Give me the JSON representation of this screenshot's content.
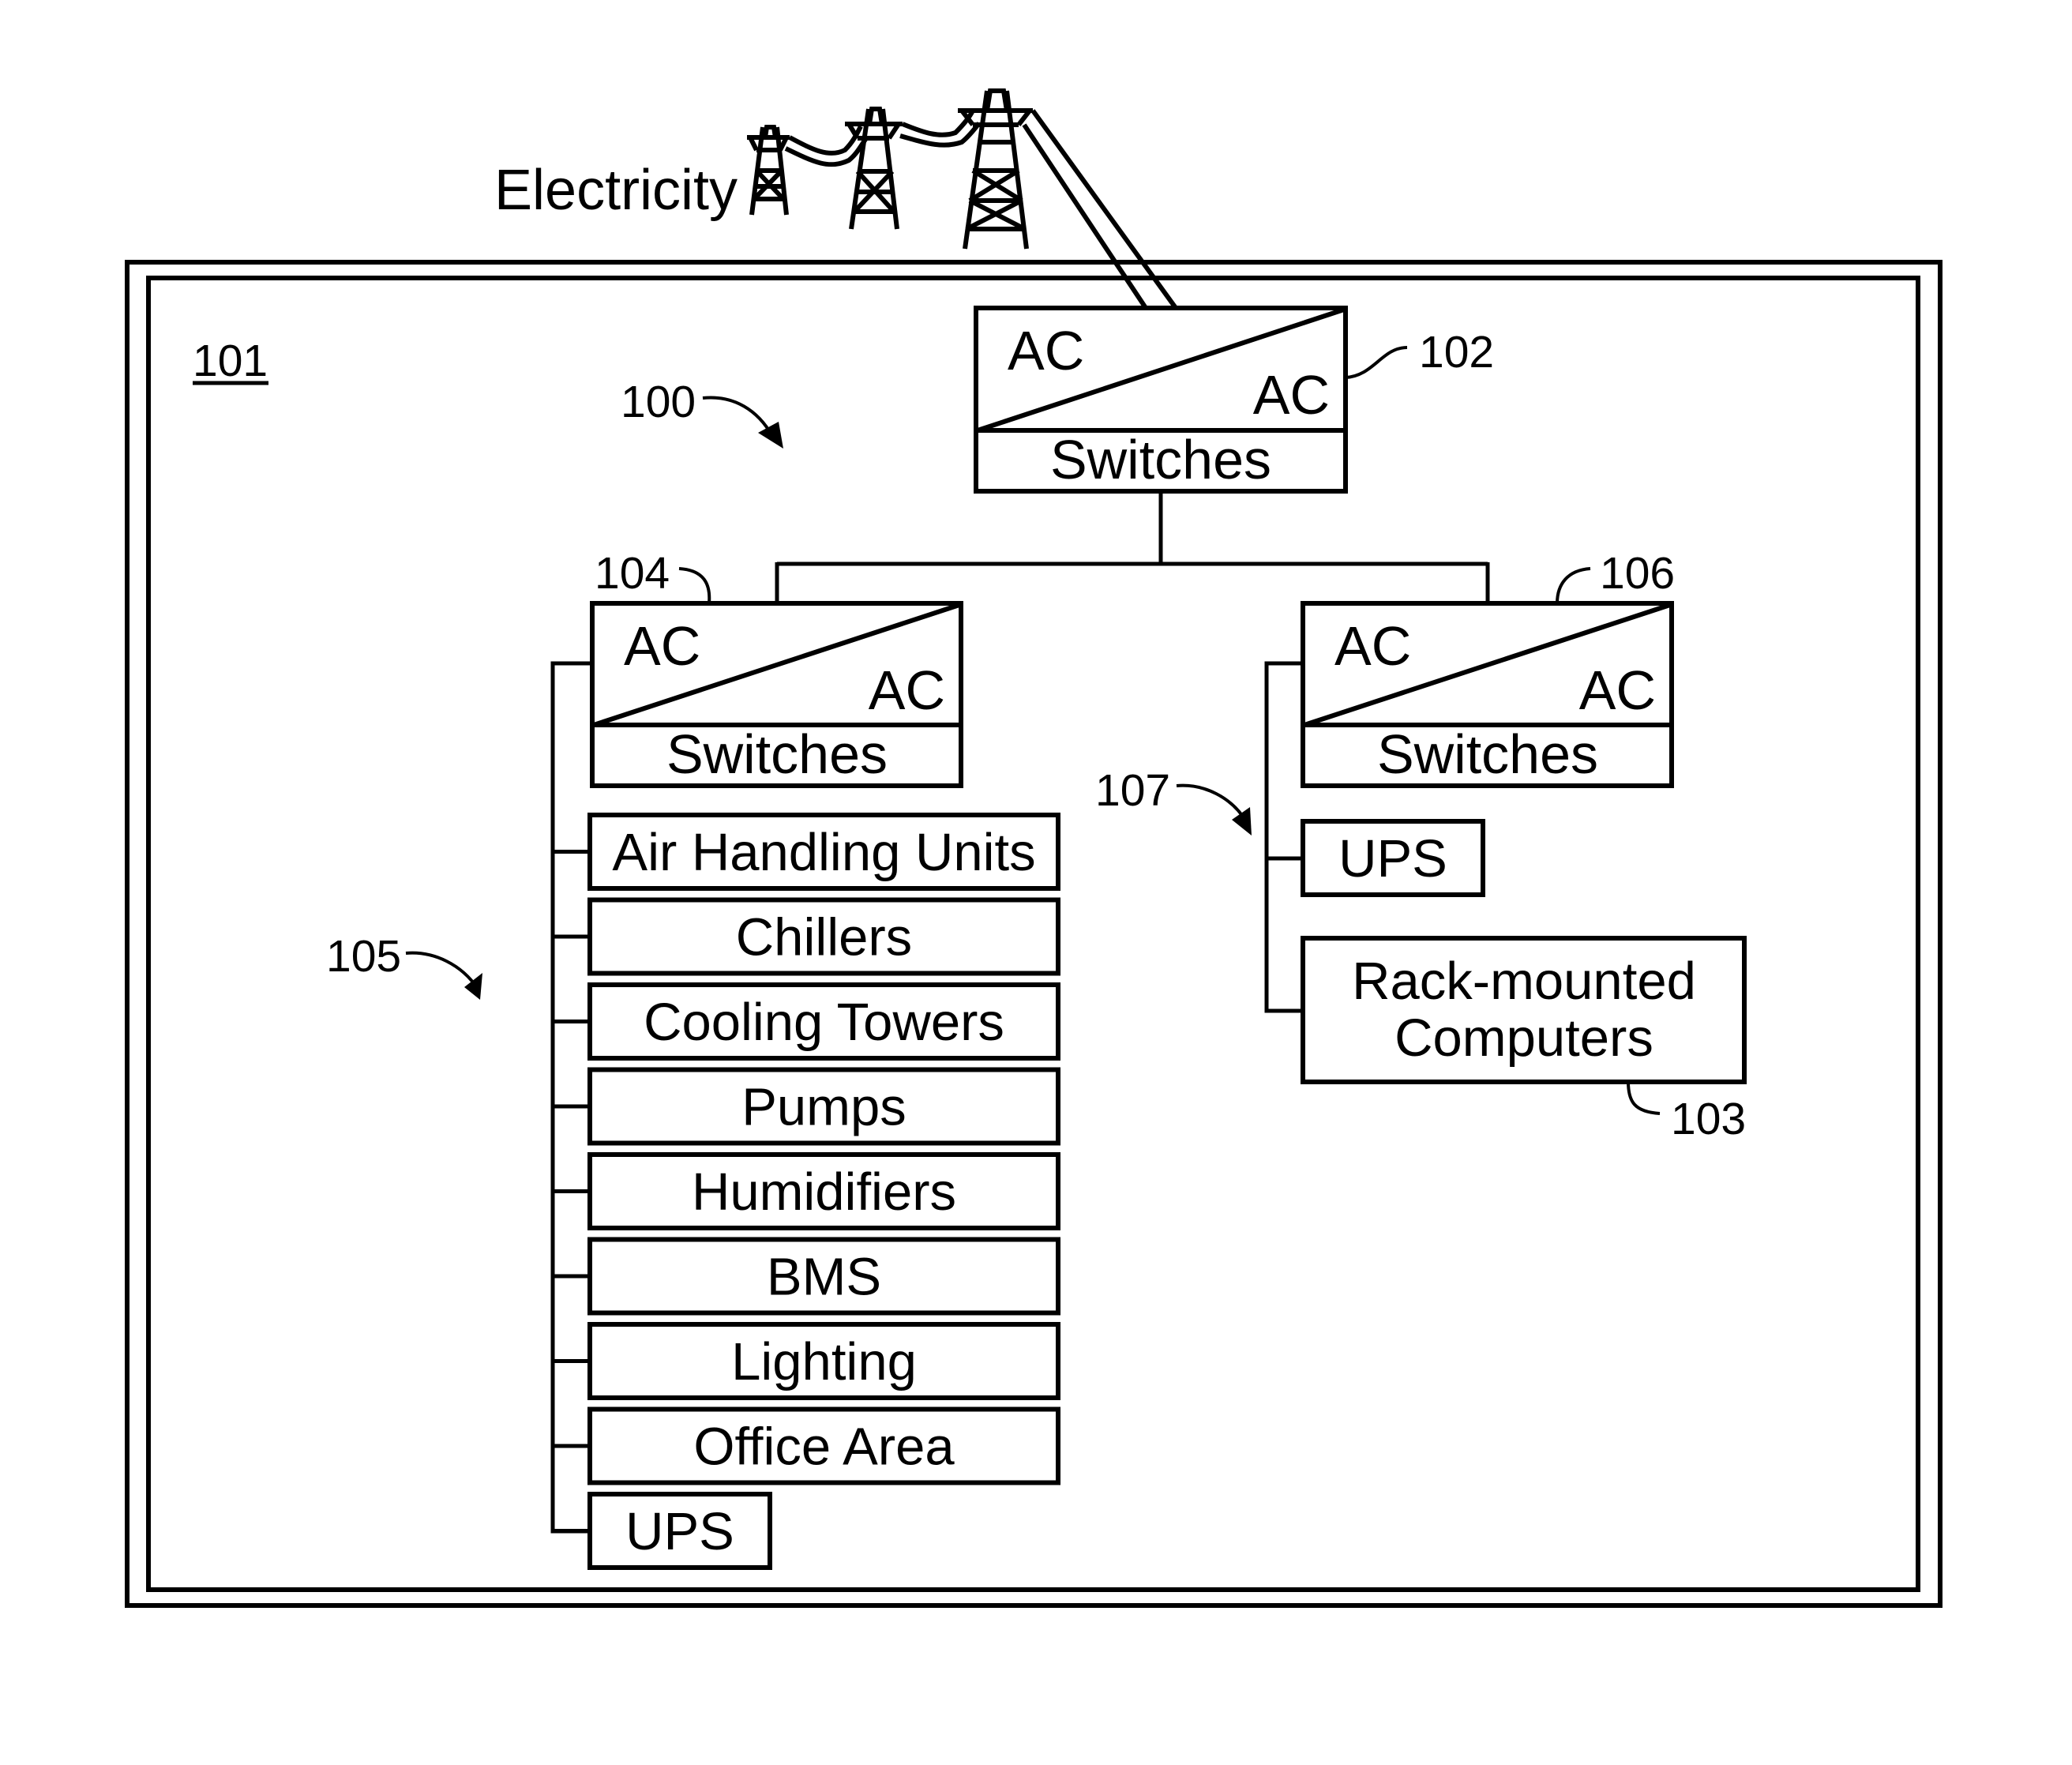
{
  "figure": {
    "source_label": "Electricity",
    "facility_ref": "101",
    "system_ref": "100",
    "colors": {
      "line": "#000000",
      "background": "#ffffff"
    }
  },
  "main_switchgear": {
    "ref": "102",
    "input_label": "AC",
    "output_label": "AC",
    "caption": "Switches"
  },
  "left_switchgear": {
    "ref": "104",
    "input_label": "AC",
    "output_label": "AC",
    "caption": "Switches",
    "group_ref": "105",
    "loads": [
      "Air Handling Units",
      "Chillers",
      "Cooling Towers",
      "Pumps",
      "Humidifiers",
      "BMS",
      "Lighting",
      "Office Area",
      "UPS"
    ]
  },
  "right_switchgear": {
    "ref": "106",
    "input_label": "AC",
    "output_label": "AC",
    "caption": "Switches",
    "group_ref": "107",
    "ups_label": "UPS",
    "computers_label_line1": "Rack-mounted",
    "computers_label_line2": "Computers",
    "computers_ref": "103"
  }
}
